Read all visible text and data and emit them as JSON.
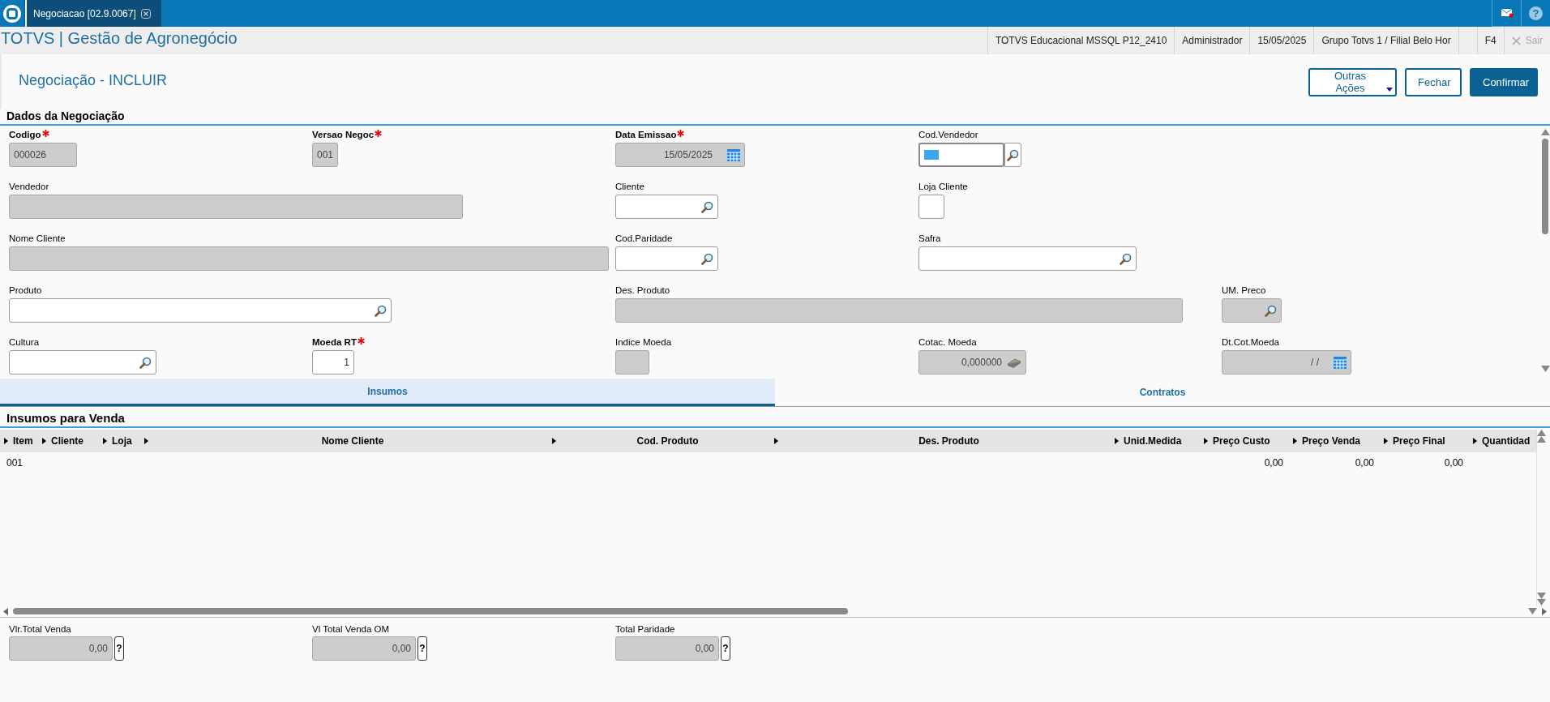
{
  "top_bar": {
    "tab_title": "Negociacao [02.9.0067]",
    "help_glyph": "?"
  },
  "info_bar": {
    "app_title": "TOTVS | Gestão de Agronegócio",
    "items": [
      "TOTVS Educacional MSSQL P12_2410",
      "Administrador",
      "15/05/2025",
      "Grupo Totvs 1 / Filial Belo Hor"
    ],
    "shortcut": "F4",
    "exit": {
      "label": "Sair",
      "disabled": true
    }
  },
  "page": {
    "title": "Negociação - INCLUIR",
    "actions": [
      {
        "label": "Outras Ações",
        "kind": "menu"
      },
      {
        "label": "Fechar",
        "kind": "outline"
      },
      {
        "label": "Confirmar",
        "kind": "primary"
      }
    ]
  },
  "form": {
    "title": "Dados da Negociação",
    "rows": [
      {
        "fields": [
          {
            "label": "Codigo",
            "value": "000026",
            "kind": "text",
            "required": true,
            "disabled": true
          },
          {
            "label": "Versao Negoc",
            "value": "001",
            "kind": "text",
            "required": true,
            "disabled": true
          },
          {
            "label": "Data Emissao",
            "value": "15/05/2025",
            "kind": "date",
            "required": true,
            "disabled": true
          },
          {
            "label": "Cod.Vendedor",
            "kind": "lookup_button",
            "required": false,
            "disabled": false,
            "focused": true
          }
        ]
      },
      {
        "fields": [
          {
            "label": "Vendedor",
            "kind": "text",
            "required": false,
            "disabled": true
          },
          {
            "label": "Cliente",
            "kind": "lookup",
            "required": false,
            "disabled": false
          },
          {
            "label": "Loja Cliente",
            "kind": "text",
            "required": false,
            "disabled": false
          }
        ]
      },
      {
        "fields": [
          {
            "label": "Nome Cliente",
            "kind": "text",
            "required": false,
            "disabled": true
          },
          {
            "label": "Cod.Paridade",
            "kind": "lookup",
            "required": false,
            "disabled": false
          },
          {
            "label": "Safra",
            "kind": "lookup",
            "required": false,
            "disabled": false
          }
        ]
      },
      {
        "fields": [
          {
            "label": "Produto",
            "kind": "lookup",
            "required": false,
            "disabled": false
          },
          {
            "label": "Des. Produto",
            "kind": "text",
            "required": false,
            "disabled": true
          },
          {
            "label": "UM. Preco",
            "kind": "lookup",
            "required": false,
            "disabled": true
          }
        ]
      },
      {
        "fields": [
          {
            "label": "Cultura",
            "kind": "lookup",
            "required": false,
            "disabled": false
          },
          {
            "label": "Moeda RT",
            "value": "1",
            "kind": "number",
            "required": true,
            "disabled": false
          },
          {
            "label": "Indice Moeda",
            "kind": "text",
            "required": false,
            "disabled": true
          },
          {
            "label": "Cotac. Moeda",
            "value": "0,000000",
            "kind": "calc",
            "required": false,
            "disabled": true
          },
          {
            "label": "Dt.Cot.Moeda",
            "value": "/ /",
            "kind": "date",
            "required": false,
            "disabled": true
          }
        ]
      }
    ]
  },
  "tabs": [
    {
      "label": "Insumos",
      "selected": true
    },
    {
      "label": "Contratos",
      "selected": false
    }
  ],
  "grid": {
    "title": "Insumos para Venda",
    "columns": [
      {
        "label": "Item"
      },
      {
        "label": "Cliente"
      },
      {
        "label": "Loja"
      },
      {
        "label": "Nome Cliente"
      },
      {
        "label": "Cod. Produto"
      },
      {
        "label": "Des. Produto"
      },
      {
        "label": "Unid.Medida"
      },
      {
        "label": "Preço Custo"
      },
      {
        "label": "Preço Venda"
      },
      {
        "label": "Preço Final"
      },
      {
        "label": "Quantidad"
      }
    ],
    "rows": [
      {
        "cells": [
          "001",
          null,
          null,
          null,
          null,
          null,
          null,
          "0,00",
          "0,00",
          "0,00",
          null
        ]
      }
    ]
  },
  "totals": [
    {
      "label": "Vlr.Total Venda",
      "value": "0,00",
      "help": "?"
    },
    {
      "label": "Vl Total Venda OM",
      "value": "0,00",
      "help": "?"
    },
    {
      "label": "Total Paridade",
      "value": "0,00",
      "help": "?"
    }
  ]
}
